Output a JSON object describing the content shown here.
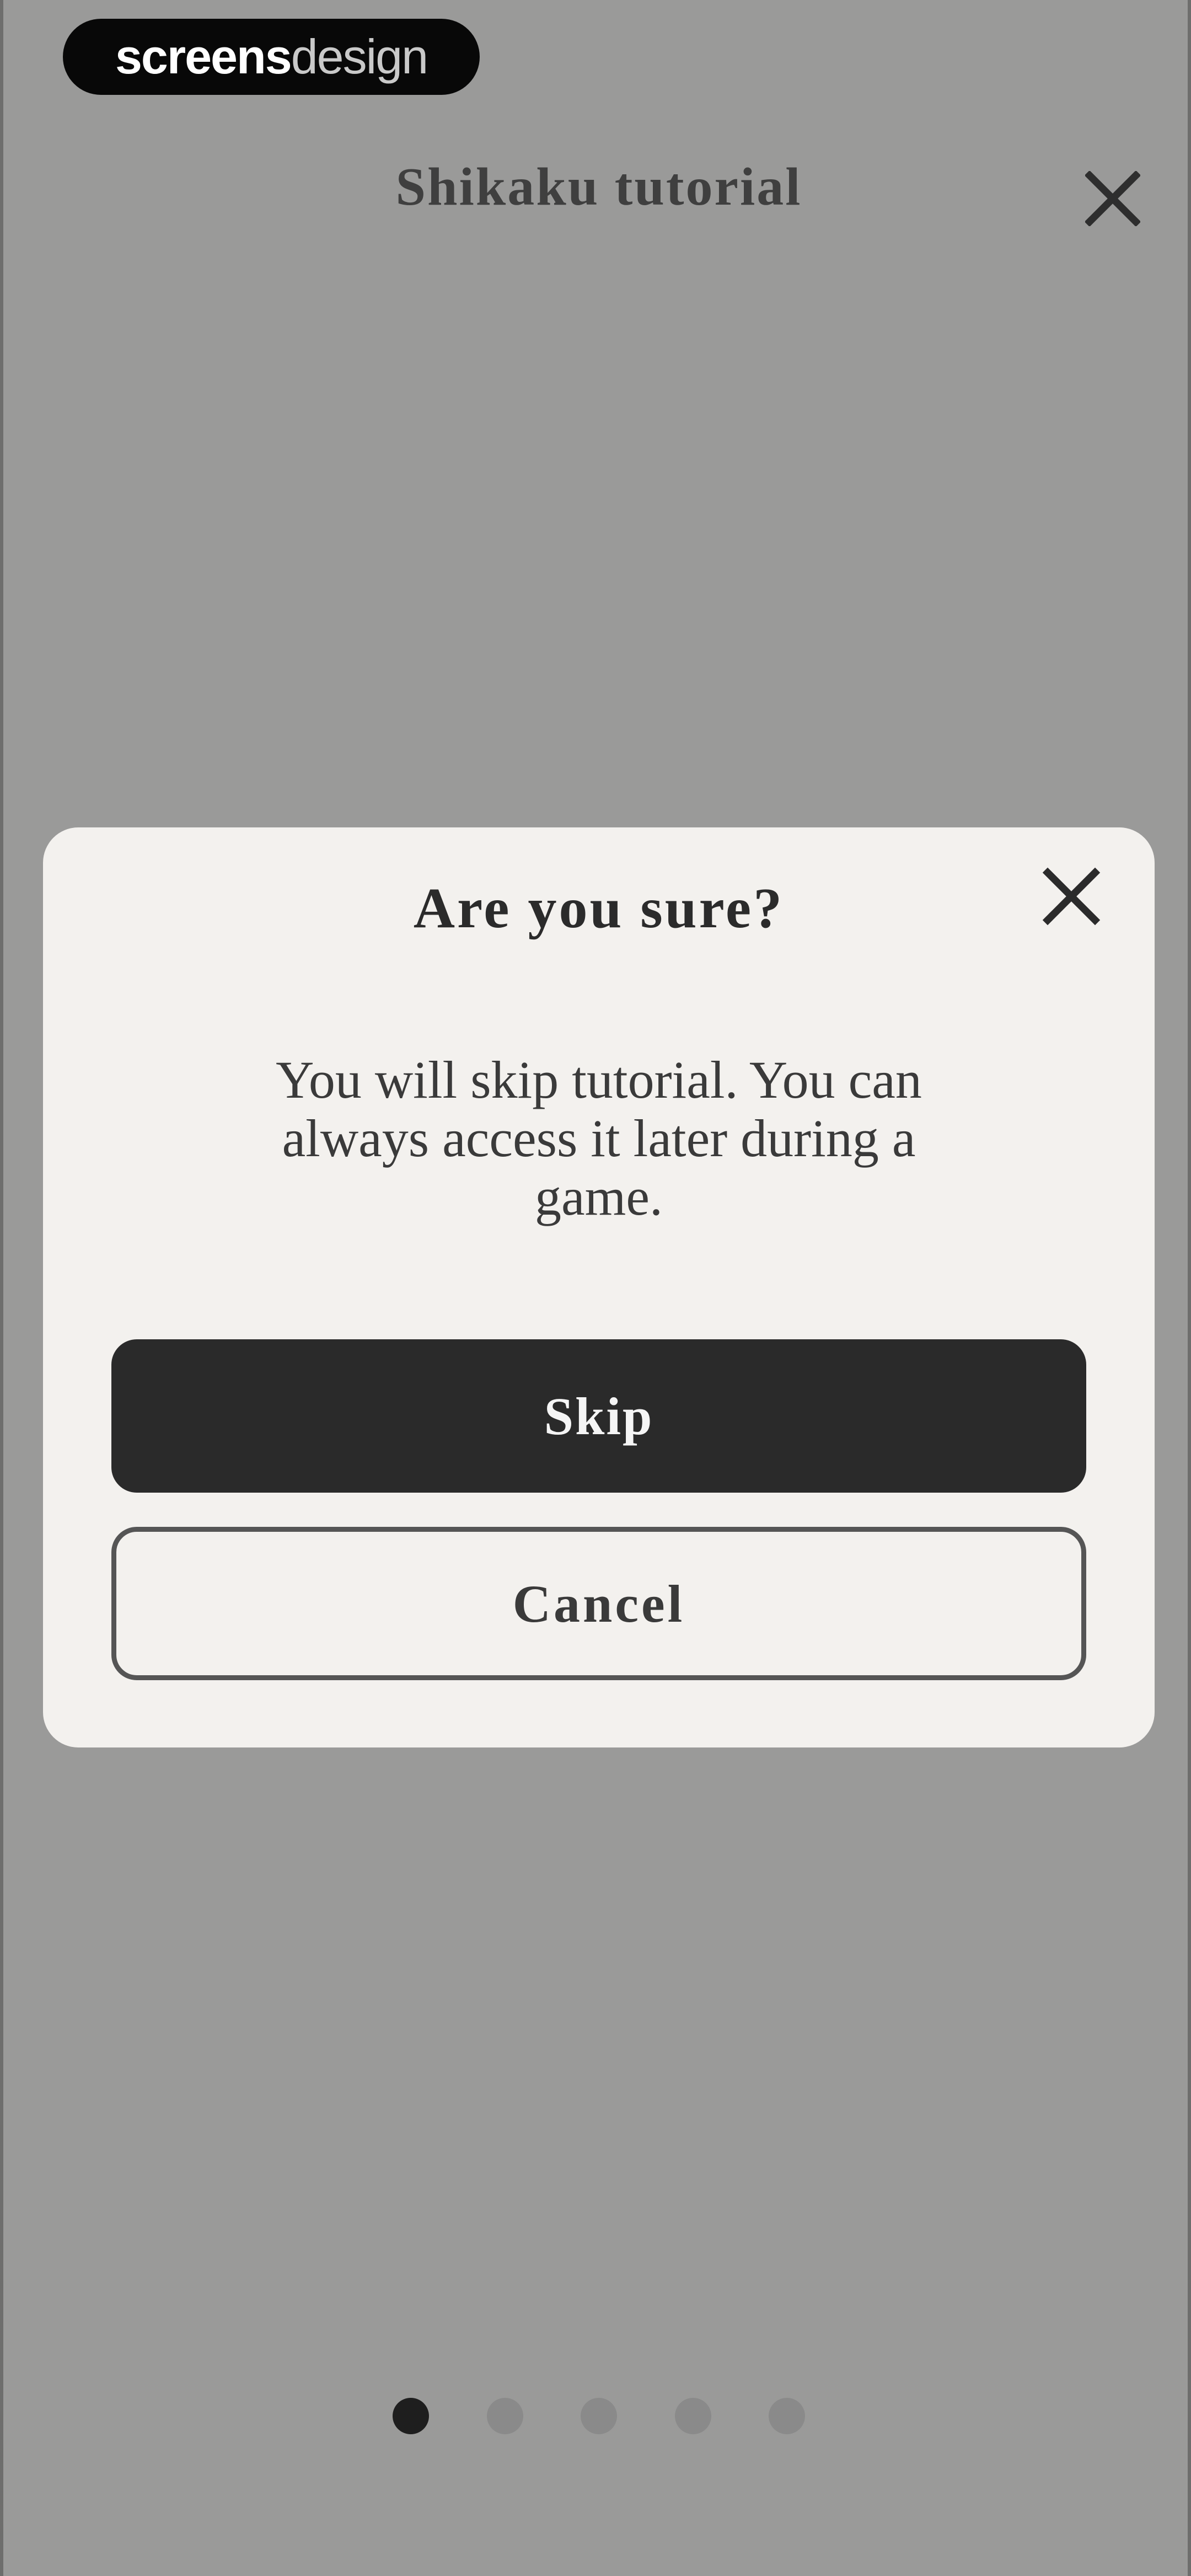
{
  "watermark": {
    "brand_bold": "screens",
    "brand_light": "design"
  },
  "header": {
    "title": "Shikaku tutorial",
    "close_icon": "close-icon"
  },
  "dialog": {
    "title": "Are you sure?",
    "message": "You will skip tutorial. You can always access it later during a game.",
    "close_icon": "close-icon",
    "primary_button": "Skip",
    "secondary_button": "Cancel"
  },
  "pagination": {
    "total": 5,
    "current": 1
  },
  "colors": {
    "overlay": "#9a9a99",
    "dialog_bg": "#f3f1ee",
    "primary_button_bg": "#2a2a2a",
    "active_dot": "#1e1e1e",
    "inactive_dot": "#8a8a8a"
  }
}
